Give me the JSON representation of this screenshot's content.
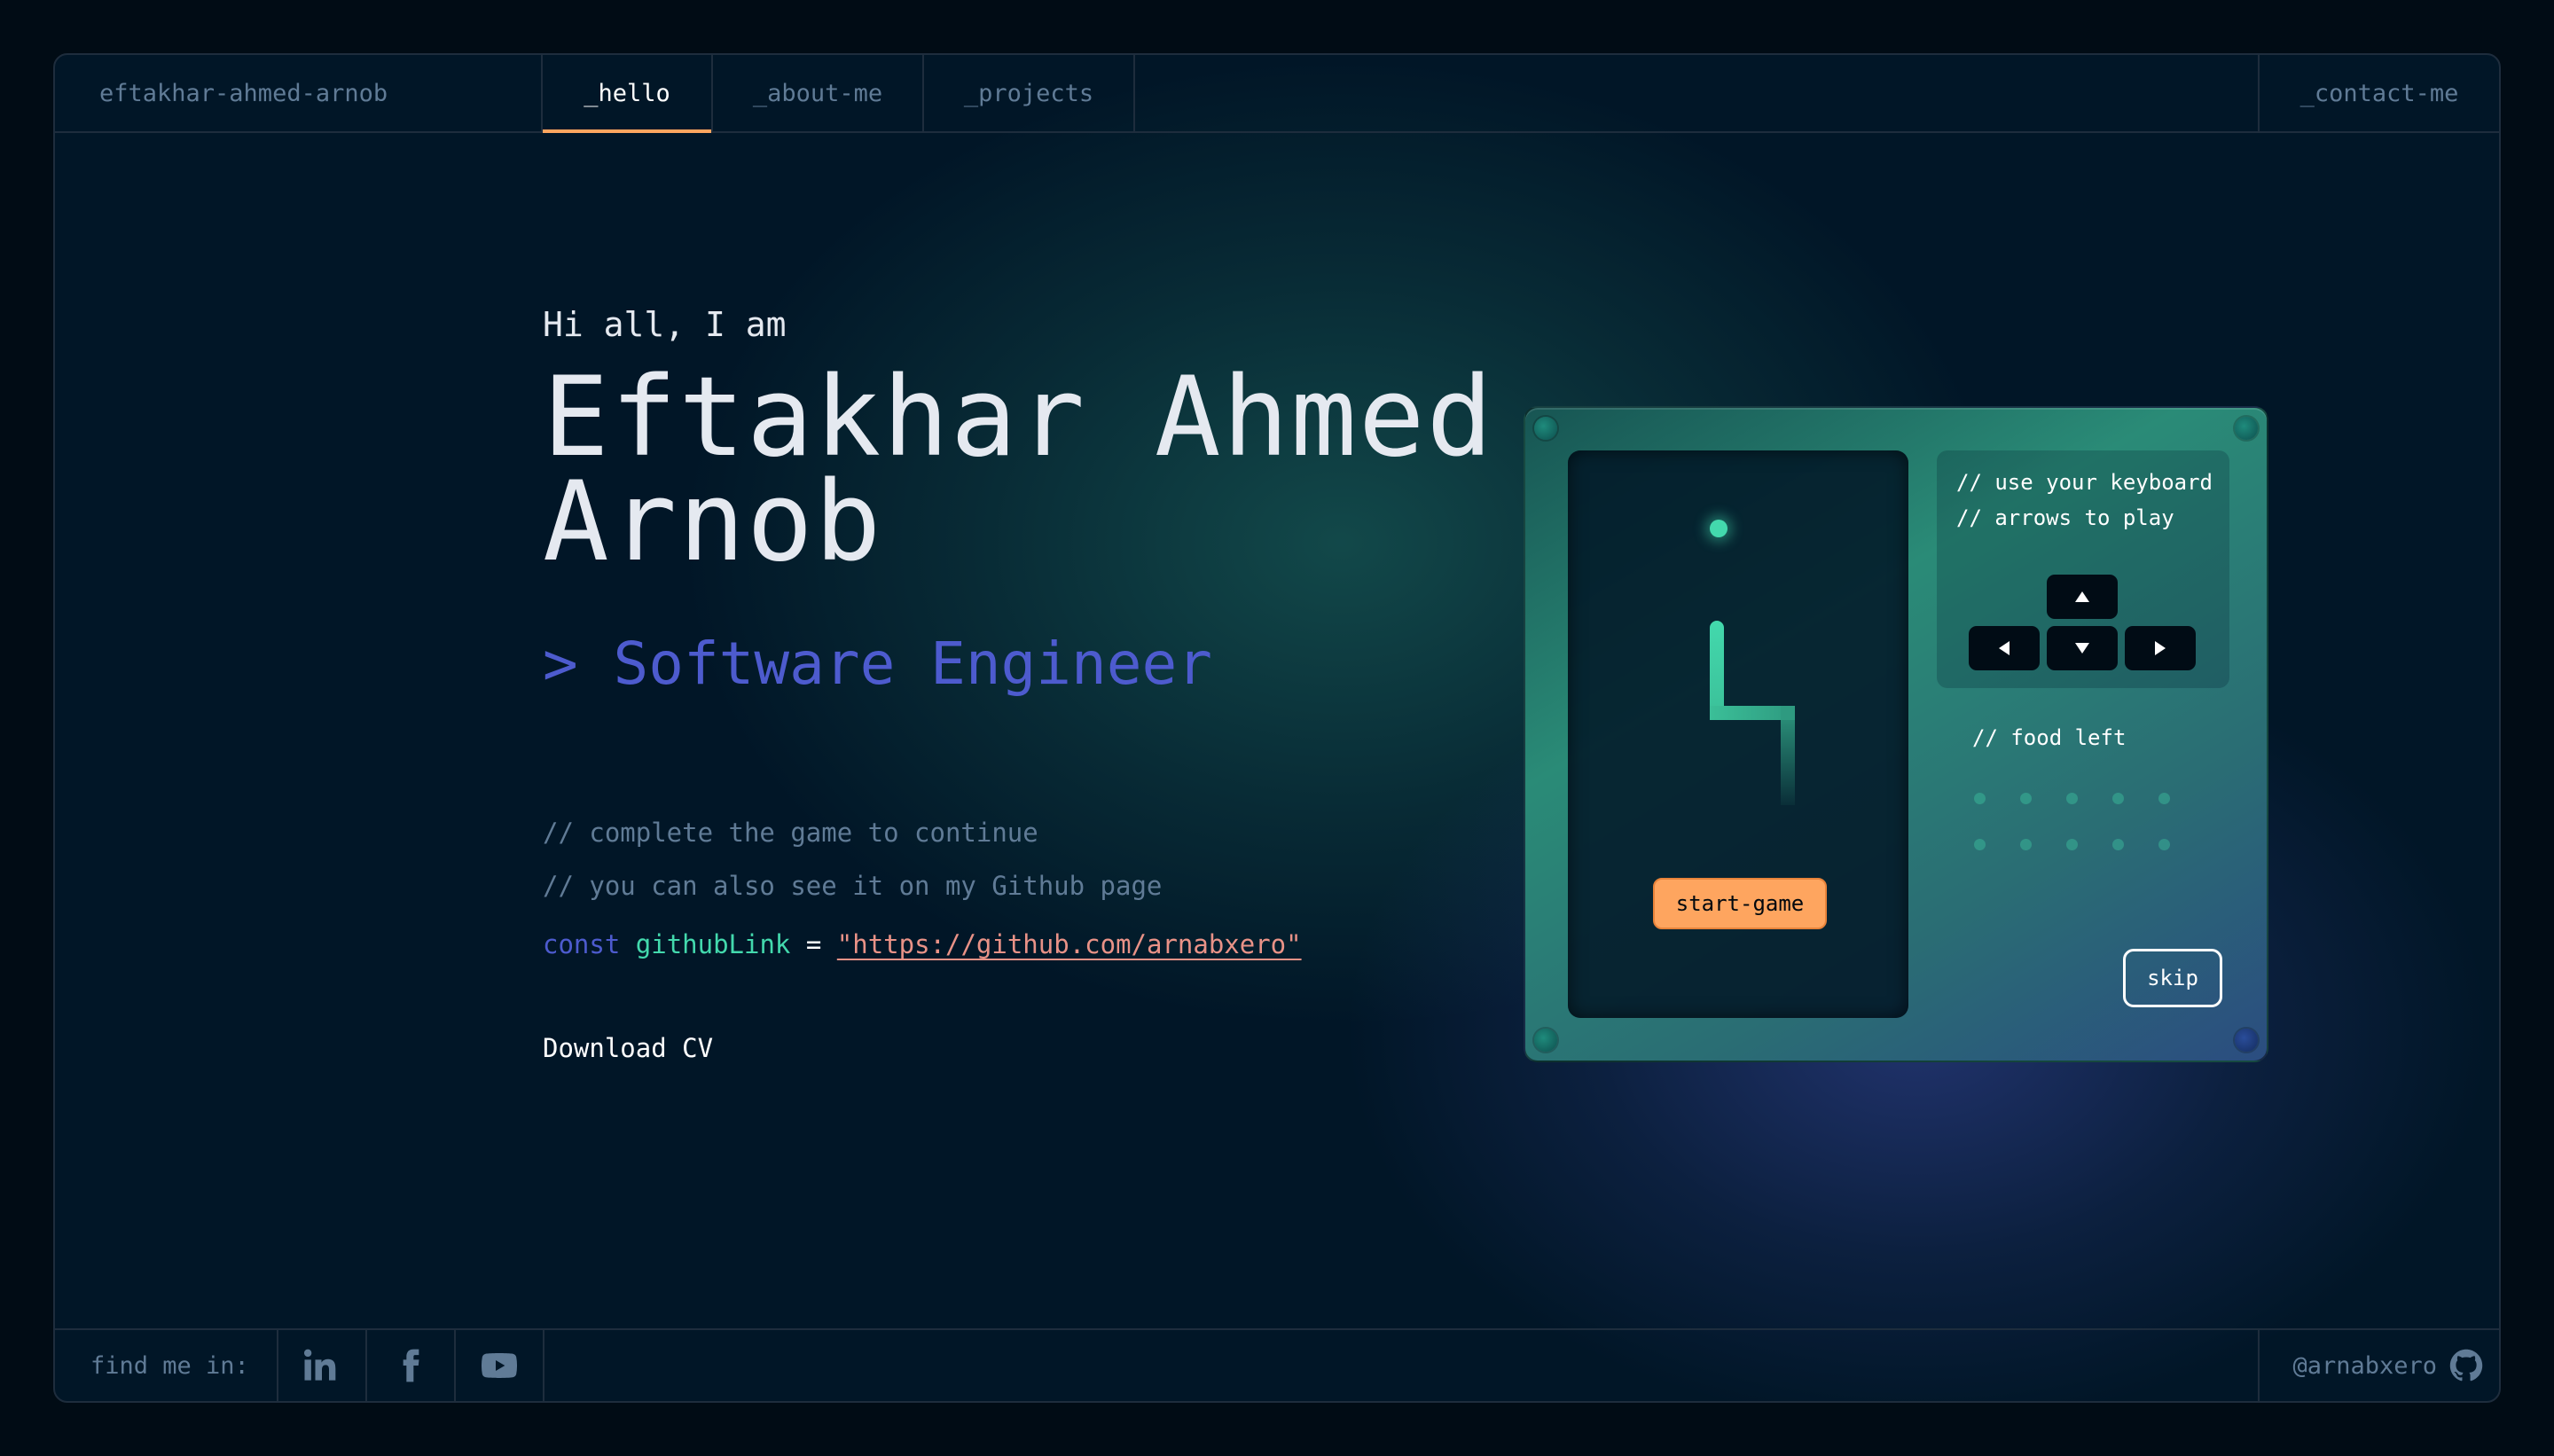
{
  "header": {
    "brand": "eftakhar-ahmed-arnob",
    "tabs": [
      {
        "label": "_hello",
        "active": true
      },
      {
        "label": "_about-me",
        "active": false
      },
      {
        "label": "_projects",
        "active": false
      }
    ],
    "contact": "_contact-me"
  },
  "hero": {
    "greeting": "Hi all, I am",
    "name_line1": "Eftakhar Ahmed",
    "name_line2": "Arnob",
    "role": "> Software Engineer",
    "comment1": "// complete the game to continue",
    "comment2": "// you can also see it on my Github page",
    "code": {
      "keyword": "const",
      "variable": "githubLink",
      "operator": "=",
      "value": "\"https://github.com/arnabxero\""
    },
    "download_cv": "Download CV"
  },
  "game": {
    "instructions_line1": "// use your keyboard",
    "instructions_line2": "// arrows to play",
    "food_left_label": "// food left",
    "food_left_count": 10,
    "start_label": "start-game",
    "skip_label": "skip"
  },
  "footer": {
    "find_me": "find me in:",
    "socials": [
      "linkedin-icon",
      "facebook-icon",
      "youtube-icon"
    ],
    "username": "@arnabxero",
    "user_icon": "github-icon"
  },
  "colors": {
    "background": "#011627",
    "border": "#1e2d3d",
    "accent_orange": "#fea55f",
    "accent_teal": "#43d9ad",
    "accent_blue": "#4d5bce",
    "string_pink": "#e99287"
  }
}
